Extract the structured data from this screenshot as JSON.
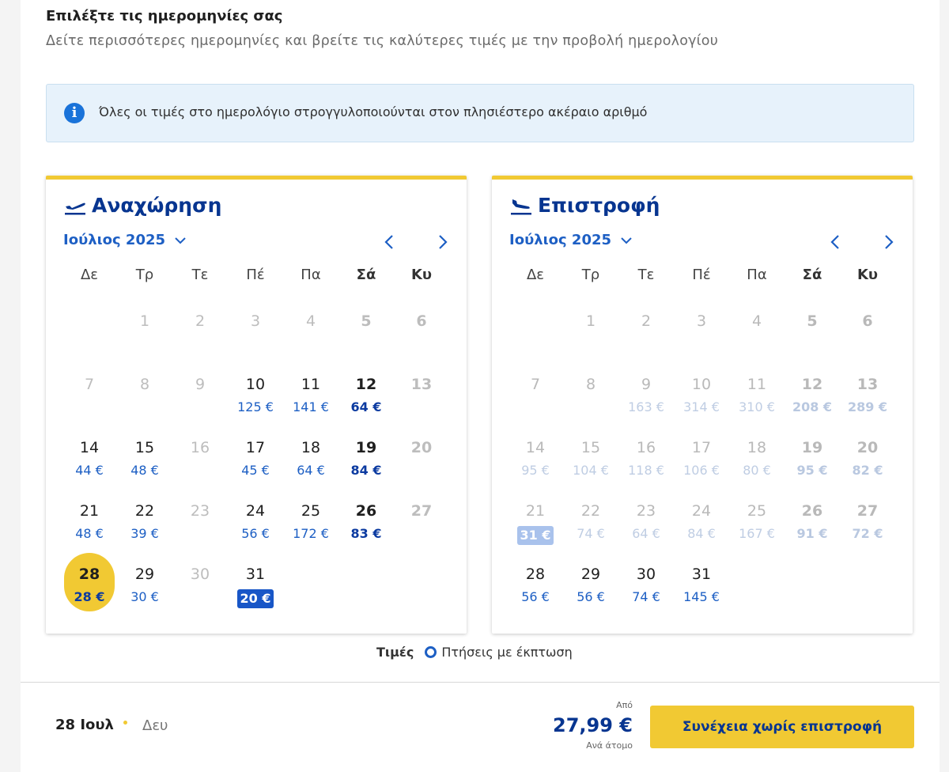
{
  "header": {
    "title": "Επιλέξτε τις ημερομηνίες σας",
    "subtitle": "Δείτε περισσότερες ημερομηνίες και βρείτε τις καλύτερες τιμές με την προβολή ημερολογίου"
  },
  "info": {
    "icon": "info-icon",
    "text": "Όλες οι τιμές στο ημερολόγιο στρογγυλοποιούνται στον πλησιέστερο ακέραιο αριθμό"
  },
  "weekdays": [
    "Δε",
    "Τρ",
    "Τε",
    "Πέ",
    "Πα",
    "Σά",
    "Κυ"
  ],
  "departure": {
    "title": "Αναχώρηση",
    "icon": "plane-takeoff-icon",
    "month": "Ιούλιος 2025",
    "days": [
      {
        "d": "",
        "p": "",
        "s": "empty"
      },
      {
        "d": "1",
        "p": "",
        "s": "dis"
      },
      {
        "d": "2",
        "p": "",
        "s": "dis"
      },
      {
        "d": "3",
        "p": "",
        "s": "dis"
      },
      {
        "d": "4",
        "p": "",
        "s": "dis"
      },
      {
        "d": "5",
        "p": "",
        "s": "dis"
      },
      {
        "d": "6",
        "p": "",
        "s": "dis"
      },
      {
        "d": "7",
        "p": "",
        "s": "dis"
      },
      {
        "d": "8",
        "p": "",
        "s": "dis"
      },
      {
        "d": "9",
        "p": "",
        "s": "dis"
      },
      {
        "d": "10",
        "p": "125 €",
        "s": "avail"
      },
      {
        "d": "11",
        "p": "141 €",
        "s": "avail"
      },
      {
        "d": "12",
        "p": "64 €",
        "s": "avail"
      },
      {
        "d": "13",
        "p": "",
        "s": "dis"
      },
      {
        "d": "14",
        "p": "44 €",
        "s": "avail"
      },
      {
        "d": "15",
        "p": "48 €",
        "s": "avail"
      },
      {
        "d": "16",
        "p": "",
        "s": "dis"
      },
      {
        "d": "17",
        "p": "45 €",
        "s": "avail"
      },
      {
        "d": "18",
        "p": "64 €",
        "s": "avail"
      },
      {
        "d": "19",
        "p": "84 €",
        "s": "avail"
      },
      {
        "d": "20",
        "p": "",
        "s": "dis"
      },
      {
        "d": "21",
        "p": "48 €",
        "s": "avail"
      },
      {
        "d": "22",
        "p": "39 €",
        "s": "avail"
      },
      {
        "d": "23",
        "p": "",
        "s": "dis"
      },
      {
        "d": "24",
        "p": "56 €",
        "s": "avail"
      },
      {
        "d": "25",
        "p": "172 €",
        "s": "avail"
      },
      {
        "d": "26",
        "p": "83 €",
        "s": "avail"
      },
      {
        "d": "27",
        "p": "",
        "s": "dis"
      },
      {
        "d": "28",
        "p": "28 €",
        "s": "sel"
      },
      {
        "d": "29",
        "p": "30 €",
        "s": "avail"
      },
      {
        "d": "30",
        "p": "",
        "s": "dis"
      },
      {
        "d": "31",
        "p": "20 €",
        "s": "low"
      }
    ]
  },
  "return": {
    "title": "Επιστροφή",
    "icon": "plane-landing-icon",
    "month": "Ιούλιος 2025",
    "days": [
      {
        "d": "",
        "p": "",
        "s": "empty"
      },
      {
        "d": "1",
        "p": "",
        "s": "ret-dis"
      },
      {
        "d": "2",
        "p": "",
        "s": "ret-dis"
      },
      {
        "d": "3",
        "p": "",
        "s": "ret-dis"
      },
      {
        "d": "4",
        "p": "",
        "s": "ret-dis"
      },
      {
        "d": "5",
        "p": "",
        "s": "ret-dis"
      },
      {
        "d": "6",
        "p": "",
        "s": "ret-dis"
      },
      {
        "d": "7",
        "p": "",
        "s": "ret-dis"
      },
      {
        "d": "8",
        "p": "",
        "s": "ret-dis"
      },
      {
        "d": "9",
        "p": "163 €",
        "s": "ret-dis"
      },
      {
        "d": "10",
        "p": "314 €",
        "s": "ret-dis"
      },
      {
        "d": "11",
        "p": "310 €",
        "s": "ret-dis"
      },
      {
        "d": "12",
        "p": "208 €",
        "s": "ret-dis"
      },
      {
        "d": "13",
        "p": "289 €",
        "s": "ret-dis"
      },
      {
        "d": "14",
        "p": "95 €",
        "s": "ret-dis"
      },
      {
        "d": "15",
        "p": "104 €",
        "s": "ret-dis"
      },
      {
        "d": "16",
        "p": "118 €",
        "s": "ret-dis"
      },
      {
        "d": "17",
        "p": "106 €",
        "s": "ret-dis"
      },
      {
        "d": "18",
        "p": "80 €",
        "s": "ret-dis"
      },
      {
        "d": "19",
        "p": "95 €",
        "s": "ret-dis"
      },
      {
        "d": "20",
        "p": "82 €",
        "s": "ret-dis"
      },
      {
        "d": "21",
        "p": "31 €",
        "s": "low-faded"
      },
      {
        "d": "22",
        "p": "74 €",
        "s": "ret-dis"
      },
      {
        "d": "23",
        "p": "64 €",
        "s": "ret-dis"
      },
      {
        "d": "24",
        "p": "84 €",
        "s": "ret-dis"
      },
      {
        "d": "25",
        "p": "167 €",
        "s": "ret-dis"
      },
      {
        "d": "26",
        "p": "91 €",
        "s": "ret-dis"
      },
      {
        "d": "27",
        "p": "72 €",
        "s": "ret-dis"
      },
      {
        "d": "28",
        "p": "56 €",
        "s": "avail"
      },
      {
        "d": "29",
        "p": "56 €",
        "s": "avail"
      },
      {
        "d": "30",
        "p": "74 €",
        "s": "avail"
      },
      {
        "d": "31",
        "p": "145 €",
        "s": "avail"
      }
    ]
  },
  "legend": {
    "title": "Τιμές",
    "item": "Πτήσεις με έκπτωση"
  },
  "footer": {
    "selected_date": "28 Ιουλ",
    "selected_day": "Δευ",
    "from_label": "Από",
    "price": "27,99 €",
    "per_person": "Ανά άτομο",
    "continue_label": "Συνέχεια χωρίς επιστροφή"
  },
  "colors": {
    "accent_yellow": "#f1c933",
    "brand_navy": "#073590",
    "link_blue": "#1d5fc4",
    "info_bg": "#e7f2fb"
  }
}
